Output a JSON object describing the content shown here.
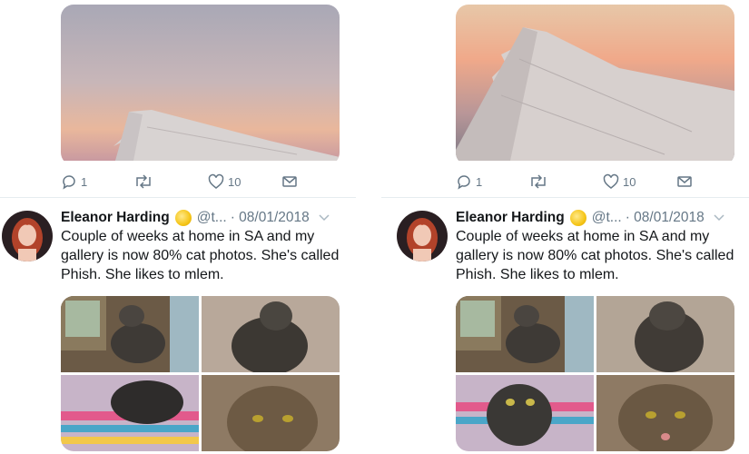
{
  "left": {
    "actions": {
      "reply_count": "1",
      "like_count": "10"
    },
    "tweet": {
      "name": "Eleanor Harding",
      "handle": "@t...",
      "date": "· 08/01/2018",
      "text": "Couple of weeks at home in SA and my gallery is now 80% cat photos. She's called Phish. She likes to mlem."
    }
  },
  "right": {
    "actions": {
      "reply_count": "1",
      "like_count": "10"
    },
    "tweet": {
      "name": "Eleanor Harding",
      "handle": "@t...",
      "date": "· 08/01/2018",
      "text": "Couple of weeks at home in SA and my gallery is now 80% cat photos. She's called Phish. She likes to mlem."
    }
  },
  "colors": {
    "icon_gray": "#657786",
    "divider": "#e6ecf0",
    "text": "#14171a"
  },
  "icons": [
    "reply-icon",
    "retweet-icon",
    "like-icon",
    "message-icon",
    "chevron-down-icon",
    "verified-badge-icon"
  ]
}
